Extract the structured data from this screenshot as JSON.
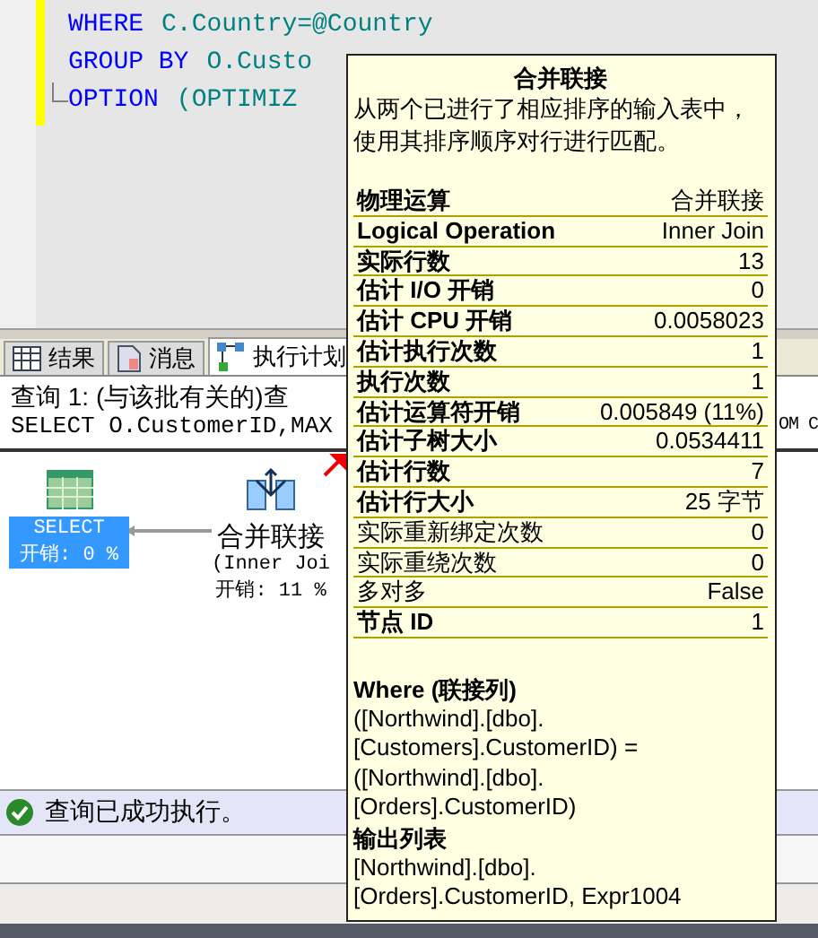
{
  "editor": {
    "lines": [
      {
        "fold_end": false,
        "tokens": [
          {
            "text": "WHERE",
            "kind": "keyword"
          },
          {
            "text": "C.Country=@Country",
            "kind": "ident"
          }
        ]
      },
      {
        "fold_end": false,
        "tokens": [
          {
            "text": "GROUP BY",
            "kind": "keyword"
          },
          {
            "text": "O.Custo",
            "kind": "ident"
          }
        ]
      },
      {
        "fold_end": true,
        "tokens": [
          {
            "text": "OPTION",
            "kind": "keyword"
          },
          {
            "text": "(OPTIMIZ",
            "kind": "ident"
          }
        ]
      }
    ]
  },
  "tabs": [
    {
      "label": "结果",
      "selected": false
    },
    {
      "label": "消息",
      "selected": false
    },
    {
      "label": "执行计划",
      "selected": true
    }
  ],
  "query": {
    "title": "查询 1: (与该批有关的)查",
    "sql": "SELECT O.CustomerID,MAX",
    "sql_tail": "OM C"
  },
  "plan": {
    "nodes": [
      {
        "kind": "select",
        "label": "SELECT",
        "cost": "开销: 0 %",
        "selected": true
      },
      {
        "kind": "merge_join",
        "label": "合并联接",
        "subtitle": "(Inner Joi",
        "cost": "开销: 11 %",
        "selected": false
      }
    ]
  },
  "tooltip": {
    "title": "合并联接",
    "description": "从两个已进行了相应排序的输入表中，使用其排序顺序对行进行匹配。",
    "rows": [
      {
        "label": "物理运算",
        "value": "合并联接",
        "bold": true
      },
      {
        "label": "Logical Operation",
        "value": "Inner Join",
        "bold": true
      },
      {
        "label": "实际行数",
        "value": "13",
        "bold": true
      },
      {
        "label": "估计 I/O 开销",
        "value": "0",
        "bold": true
      },
      {
        "label": "估计 CPU 开销",
        "value": "0.0058023",
        "bold": true
      },
      {
        "label": "估计执行次数",
        "value": "1",
        "bold": true
      },
      {
        "label": "执行次数",
        "value": "1",
        "bold": true
      },
      {
        "label": "估计运算符开销",
        "value": "0.005849 (11%)",
        "bold": true
      },
      {
        "label": "估计子树大小",
        "value": "0.0534411",
        "bold": true
      },
      {
        "label": "估计行数",
        "value": "7",
        "bold": true
      },
      {
        "label": "估计行大小",
        "value": "25 字节",
        "bold": true
      },
      {
        "label": "实际重新绑定次数",
        "value": "0",
        "bold": false
      },
      {
        "label": "实际重绕次数",
        "value": "0",
        "bold": false
      },
      {
        "label": "多对多",
        "value": "False",
        "bold": false
      },
      {
        "label": "节点 ID",
        "value": "1",
        "bold": true
      }
    ],
    "sections": [
      {
        "heading": "Where (联接列)",
        "lines": [
          "([Northwind].[dbo].",
          "[Customers].CustomerID) =",
          "([Northwind].[dbo].",
          "[Orders].CustomerID)"
        ]
      },
      {
        "heading": "输出列表",
        "lines": [
          "[Northwind].[dbo].",
          "[Orders].CustomerID, Expr1004"
        ]
      }
    ]
  },
  "status": {
    "message": "查询已成功执行。"
  }
}
